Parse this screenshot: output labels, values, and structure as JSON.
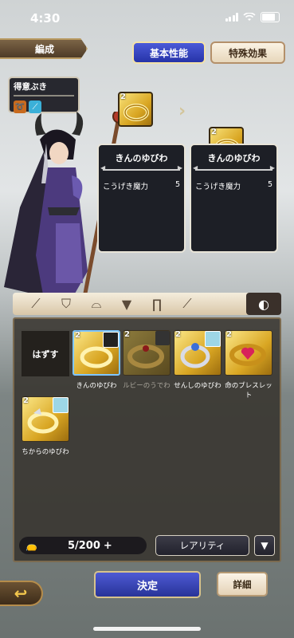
{
  "status": {
    "time": "4:30"
  },
  "header": {
    "title": "編成"
  },
  "tabs": {
    "basic": "基本性能",
    "special": "特殊効果"
  },
  "skill": {
    "title": "得意ぶき"
  },
  "compare": {
    "left": {
      "name": "きんのゆびわ",
      "stat_label": "こうげき魔力",
      "stat_value": "5"
    },
    "right": {
      "name": "きんのゆびわ",
      "stat_label": "こうげき魔力",
      "stat_value": "5"
    }
  },
  "inventory": {
    "remove_label": "はずす",
    "items": [
      {
        "name": "きんのゆびわ",
        "stars": "2"
      },
      {
        "name": "ルビーのうでわ",
        "stars": "2"
      },
      {
        "name": "せんしのゆびわ",
        "stars": "2"
      },
      {
        "name": "命のブレスレット",
        "stars": "2"
      },
      {
        "name": "ちからのゆびわ",
        "stars": "2"
      }
    ]
  },
  "footer": {
    "capacity": "5/200",
    "rarity_label": "レアリティ",
    "confirm_label": "決定",
    "detail_label": "詳細"
  },
  "colors": {
    "accent_blue": "#2f3cb5",
    "gold": "#e2b12f",
    "panel": "#1d1f26"
  }
}
